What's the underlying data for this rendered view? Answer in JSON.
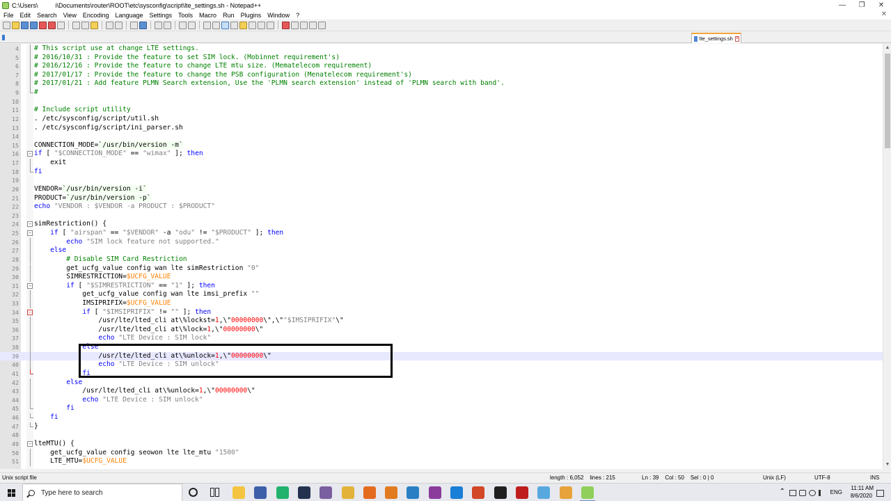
{
  "window": {
    "title": "C:\\Users\\          i\\Documents\\router\\ROOT\\etc\\sysconfig\\script\\lte_settings.sh - Notepad++",
    "minimize": "—",
    "maximize": "❐",
    "close": "✕"
  },
  "menu": {
    "items": [
      "File",
      "Edit",
      "Search",
      "View",
      "Encoding",
      "Language",
      "Settings",
      "Tools",
      "Macro",
      "Run",
      "Plugins",
      "Window",
      "?"
    ],
    "close_doc": "✕"
  },
  "tab": {
    "label": "lte_settings.sh",
    "close": "×"
  },
  "editor": {
    "current_line": 39,
    "lines": [
      {
        "n": "4",
        "fold": "line",
        "segs": [
          [
            "c",
            "# This script use at change LTE settings."
          ]
        ]
      },
      {
        "n": "5",
        "fold": "line",
        "segs": [
          [
            "c",
            "# 2016/10/31 : Provide the feature to set SIM lock. (Mobinnet requirement's)"
          ]
        ]
      },
      {
        "n": "6",
        "fold": "line",
        "segs": [
          [
            "c",
            "# 2016/12/16 : Provide the feature to change LTE mtu size. (Mematelecom requirement)"
          ]
        ]
      },
      {
        "n": "7",
        "fold": "line",
        "segs": [
          [
            "c",
            "# 2017/01/17 : Provide the feature to change the PSB configuration (Menatelecom requirement's)"
          ]
        ]
      },
      {
        "n": "8",
        "fold": "line",
        "segs": [
          [
            "c",
            "# 2017/01/21 : Add feature PLMN Search extension, Use the 'PLMN search extension' instead of 'PLMN search with band'."
          ]
        ]
      },
      {
        "n": "9",
        "fold": "end",
        "segs": [
          [
            "c",
            "#"
          ]
        ]
      },
      {
        "n": "10",
        "fold": "",
        "segs": []
      },
      {
        "n": "11",
        "fold": "",
        "segs": [
          [
            "c",
            "# Include script utility"
          ]
        ]
      },
      {
        "n": "12",
        "fold": "",
        "segs": [
          [
            "t",
            ". /etc/sysconfig/script/util.sh"
          ]
        ]
      },
      {
        "n": "13",
        "fold": "",
        "segs": [
          [
            "t",
            ". /etc/sysconfig/script/ini_parser.sh"
          ]
        ]
      },
      {
        "n": "14",
        "fold": "",
        "segs": []
      },
      {
        "n": "15",
        "fold": "",
        "segs": [
          [
            "t",
            "CONNECTION_MODE="
          ],
          [
            "b",
            "`/usr/bin/version -m`"
          ]
        ]
      },
      {
        "n": "16",
        "fold": "open",
        "segs": [
          [
            "k",
            "if"
          ],
          [
            "t",
            " [ "
          ],
          [
            "s",
            "\"$CONNECTION_MODE\""
          ],
          [
            "t",
            " == "
          ],
          [
            "s",
            "\"wimax\""
          ],
          [
            "t",
            " ]; "
          ],
          [
            "k",
            "then"
          ]
        ]
      },
      {
        "n": "17",
        "fold": "line",
        "segs": [
          [
            "t",
            "    exit"
          ]
        ]
      },
      {
        "n": "18",
        "fold": "end",
        "segs": [
          [
            "k",
            "fi"
          ]
        ]
      },
      {
        "n": "19",
        "fold": "",
        "segs": []
      },
      {
        "n": "20",
        "fold": "",
        "segs": [
          [
            "t",
            "VENDOR="
          ],
          [
            "b",
            "`/usr/bin/version -i`"
          ]
        ]
      },
      {
        "n": "21",
        "fold": "",
        "segs": [
          [
            "t",
            "PRODUCT="
          ],
          [
            "b",
            "`/usr/bin/version -p`"
          ]
        ]
      },
      {
        "n": "22",
        "fold": "",
        "segs": [
          [
            "k",
            "echo"
          ],
          [
            "t",
            " "
          ],
          [
            "s",
            "\"VENDOR : $VENDOR -a PRODUCT : $PRODUCT\""
          ]
        ]
      },
      {
        "n": "23",
        "fold": "",
        "segs": []
      },
      {
        "n": "24",
        "fold": "open",
        "segs": [
          [
            "t",
            "simRestriction() {"
          ]
        ]
      },
      {
        "n": "25",
        "fold": "open",
        "segs": [
          [
            "t",
            "    "
          ],
          [
            "k",
            "if"
          ],
          [
            "t",
            " [ "
          ],
          [
            "s",
            "\"airspan\""
          ],
          [
            "t",
            " == "
          ],
          [
            "s",
            "\"$VENDOR\""
          ],
          [
            "t",
            " -a "
          ],
          [
            "s",
            "\"odu\""
          ],
          [
            "t",
            " != "
          ],
          [
            "s",
            "\"$PRODUCT\""
          ],
          [
            "t",
            " ]; "
          ],
          [
            "k",
            "then"
          ]
        ]
      },
      {
        "n": "26",
        "fold": "line",
        "segs": [
          [
            "t",
            "        "
          ],
          [
            "k",
            "echo"
          ],
          [
            "t",
            " "
          ],
          [
            "s",
            "\"SIM lock feature not supported.\""
          ]
        ]
      },
      {
        "n": "27",
        "fold": "line",
        "segs": [
          [
            "t",
            "    "
          ],
          [
            "k",
            "else"
          ]
        ]
      },
      {
        "n": "28",
        "fold": "line",
        "segs": [
          [
            "t",
            "        "
          ],
          [
            "c",
            "# Disable SIM Card Restriction"
          ]
        ]
      },
      {
        "n": "29",
        "fold": "line",
        "segs": [
          [
            "t",
            "        get_ucfg_value config wan lte simRestriction "
          ],
          [
            "s",
            "\"0\""
          ]
        ]
      },
      {
        "n": "30",
        "fold": "line",
        "segs": [
          [
            "t",
            "        SIMRESTRICTION="
          ],
          [
            "v",
            "$UCFG_VALUE"
          ]
        ]
      },
      {
        "n": "31",
        "fold": "open",
        "segs": [
          [
            "t",
            "        "
          ],
          [
            "k",
            "if"
          ],
          [
            "t",
            " [ "
          ],
          [
            "s",
            "\"$SIMRESTRICTION\""
          ],
          [
            "t",
            " == "
          ],
          [
            "s",
            "\"1\""
          ],
          [
            "t",
            " ]; "
          ],
          [
            "k",
            "then"
          ]
        ]
      },
      {
        "n": "32",
        "fold": "line",
        "segs": [
          [
            "t",
            "            get_ucfg_value config wan lte imsi_prefix "
          ],
          [
            "s",
            "\"\""
          ]
        ]
      },
      {
        "n": "33",
        "fold": "line",
        "segs": [
          [
            "t",
            "            IMSIPRIFIX="
          ],
          [
            "v",
            "$UCFG_VALUE"
          ]
        ]
      },
      {
        "n": "34",
        "fold": "openred",
        "segs": [
          [
            "t",
            "            "
          ],
          [
            "k",
            "if"
          ],
          [
            "t",
            " [ "
          ],
          [
            "s",
            "\"$IMSIPRIFIX\""
          ],
          [
            "t",
            " != "
          ],
          [
            "s",
            "\"\""
          ],
          [
            "t",
            " ]; "
          ],
          [
            "k",
            "then"
          ]
        ]
      },
      {
        "n": "35",
        "fold": "line",
        "segs": [
          [
            "t",
            "                /usr/lte/lted_cli at\\%lockst="
          ],
          [
            "n",
            "1"
          ],
          [
            "t",
            ",\\\""
          ],
          [
            "n",
            "00000000"
          ],
          [
            "t",
            "\\\",\\\""
          ],
          [
            "s",
            "\"$IMSIPRIFIX\""
          ],
          [
            "t",
            "\\\""
          ]
        ]
      },
      {
        "n": "36",
        "fold": "line",
        "segs": [
          [
            "t",
            "                /usr/lte/lted_cli at\\%lock="
          ],
          [
            "n",
            "1"
          ],
          [
            "t",
            ",\\\""
          ],
          [
            "n",
            "00000000"
          ],
          [
            "t",
            "\\\""
          ]
        ]
      },
      {
        "n": "37",
        "fold": "line",
        "segs": [
          [
            "t",
            "                "
          ],
          [
            "k",
            "echo"
          ],
          [
            "t",
            " "
          ],
          [
            "s",
            "\"LTE Device : SIM lock\""
          ]
        ]
      },
      {
        "n": "38",
        "fold": "line",
        "segs": [
          [
            "t",
            "            "
          ],
          [
            "k",
            "else"
          ]
        ]
      },
      {
        "n": "39",
        "fold": "line",
        "segs": [
          [
            "t",
            "                /usr/lte/lted_cli at\\%unlock="
          ],
          [
            "n",
            "1"
          ],
          [
            "t",
            ",\\\""
          ],
          [
            "n",
            "00000000"
          ],
          [
            "t",
            "\\\""
          ]
        ]
      },
      {
        "n": "40",
        "fold": "line",
        "segs": [
          [
            "t",
            "                "
          ],
          [
            "k",
            "echo"
          ],
          [
            "t",
            " "
          ],
          [
            "s",
            "\"LTE Device : SIM unlock\""
          ]
        ]
      },
      {
        "n": "41",
        "fold": "endred",
        "segs": [
          [
            "t",
            "            "
          ],
          [
            "k",
            "fi"
          ]
        ]
      },
      {
        "n": "42",
        "fold": "line",
        "segs": [
          [
            "t",
            "        "
          ],
          [
            "k",
            "else"
          ]
        ]
      },
      {
        "n": "43",
        "fold": "line",
        "segs": [
          [
            "t",
            "            /usr/lte/lted_cli at\\%unlock="
          ],
          [
            "n",
            "1"
          ],
          [
            "t",
            ",\\\""
          ],
          [
            "n",
            "00000000"
          ],
          [
            "t",
            "\\\""
          ]
        ]
      },
      {
        "n": "44",
        "fold": "line",
        "segs": [
          [
            "t",
            "            "
          ],
          [
            "k",
            "echo"
          ],
          [
            "t",
            " "
          ],
          [
            "s",
            "\"LTE Device : SIM unlock\""
          ]
        ]
      },
      {
        "n": "45",
        "fold": "end",
        "segs": [
          [
            "t",
            "        "
          ],
          [
            "k",
            "fi"
          ]
        ]
      },
      {
        "n": "46",
        "fold": "end",
        "segs": [
          [
            "t",
            "    "
          ],
          [
            "k",
            "fi"
          ]
        ]
      },
      {
        "n": "47",
        "fold": "end",
        "segs": [
          [
            "t",
            "}"
          ]
        ]
      },
      {
        "n": "48",
        "fold": "",
        "segs": []
      },
      {
        "n": "49",
        "fold": "open",
        "segs": [
          [
            "t",
            "lteMTU() {"
          ]
        ]
      },
      {
        "n": "50",
        "fold": "line",
        "segs": [
          [
            "t",
            "    get_ucfg_value config seowon lte lte_mtu "
          ],
          [
            "s",
            "\"1500\""
          ]
        ]
      },
      {
        "n": "51",
        "fold": "line",
        "segs": [
          [
            "t",
            "    LTE_MTU="
          ],
          [
            "v",
            "$UCFG_VALUE"
          ]
        ]
      }
    ]
  },
  "scrollbar": {
    "up": "▲",
    "down": "▼"
  },
  "status": {
    "file_type": "Unix script file",
    "length": "length : 6,052    lines : 215",
    "position": "Ln : 39    Col : 50    Sel : 0 | 0",
    "eol": "Unix (LF)",
    "encoding": "UTF-8",
    "mode": "INS"
  },
  "taskbar": {
    "search_placeholder": "Type here to search",
    "apps": [
      {
        "name": "file-explorer",
        "color": "#f5c542"
      },
      {
        "name": "network-tool",
        "color": "#3d5ea8"
      },
      {
        "name": "sync-app",
        "color": "#23b26d"
      },
      {
        "name": "vpn-app",
        "color": "#24324f"
      },
      {
        "name": "document-app",
        "color": "#7a5fa0"
      },
      {
        "name": "chrome",
        "color": "#e2b23a"
      },
      {
        "name": "firefox",
        "color": "#e56b1f"
      },
      {
        "name": "security-app",
        "color": "#e27a1f"
      },
      {
        "name": "messenger",
        "color": "#2a7fc4"
      },
      {
        "name": "winrar",
        "color": "#8a3b9c"
      },
      {
        "name": "edge",
        "color": "#1a7fd6"
      },
      {
        "name": "office",
        "color": "#d24726"
      },
      {
        "name": "terminal",
        "color": "#1f1f1f"
      },
      {
        "name": "filezilla",
        "color": "#bf1d1d"
      },
      {
        "name": "tool-app",
        "color": "#58a8e0"
      },
      {
        "name": "sublime",
        "color": "#e8a23a"
      },
      {
        "name": "notepad-plus-plus",
        "color": "#8fcf5a"
      }
    ],
    "language": "ENG",
    "time": "11:11 AM",
    "date": "8/6/2020",
    "tray_chevron": "⌃"
  }
}
